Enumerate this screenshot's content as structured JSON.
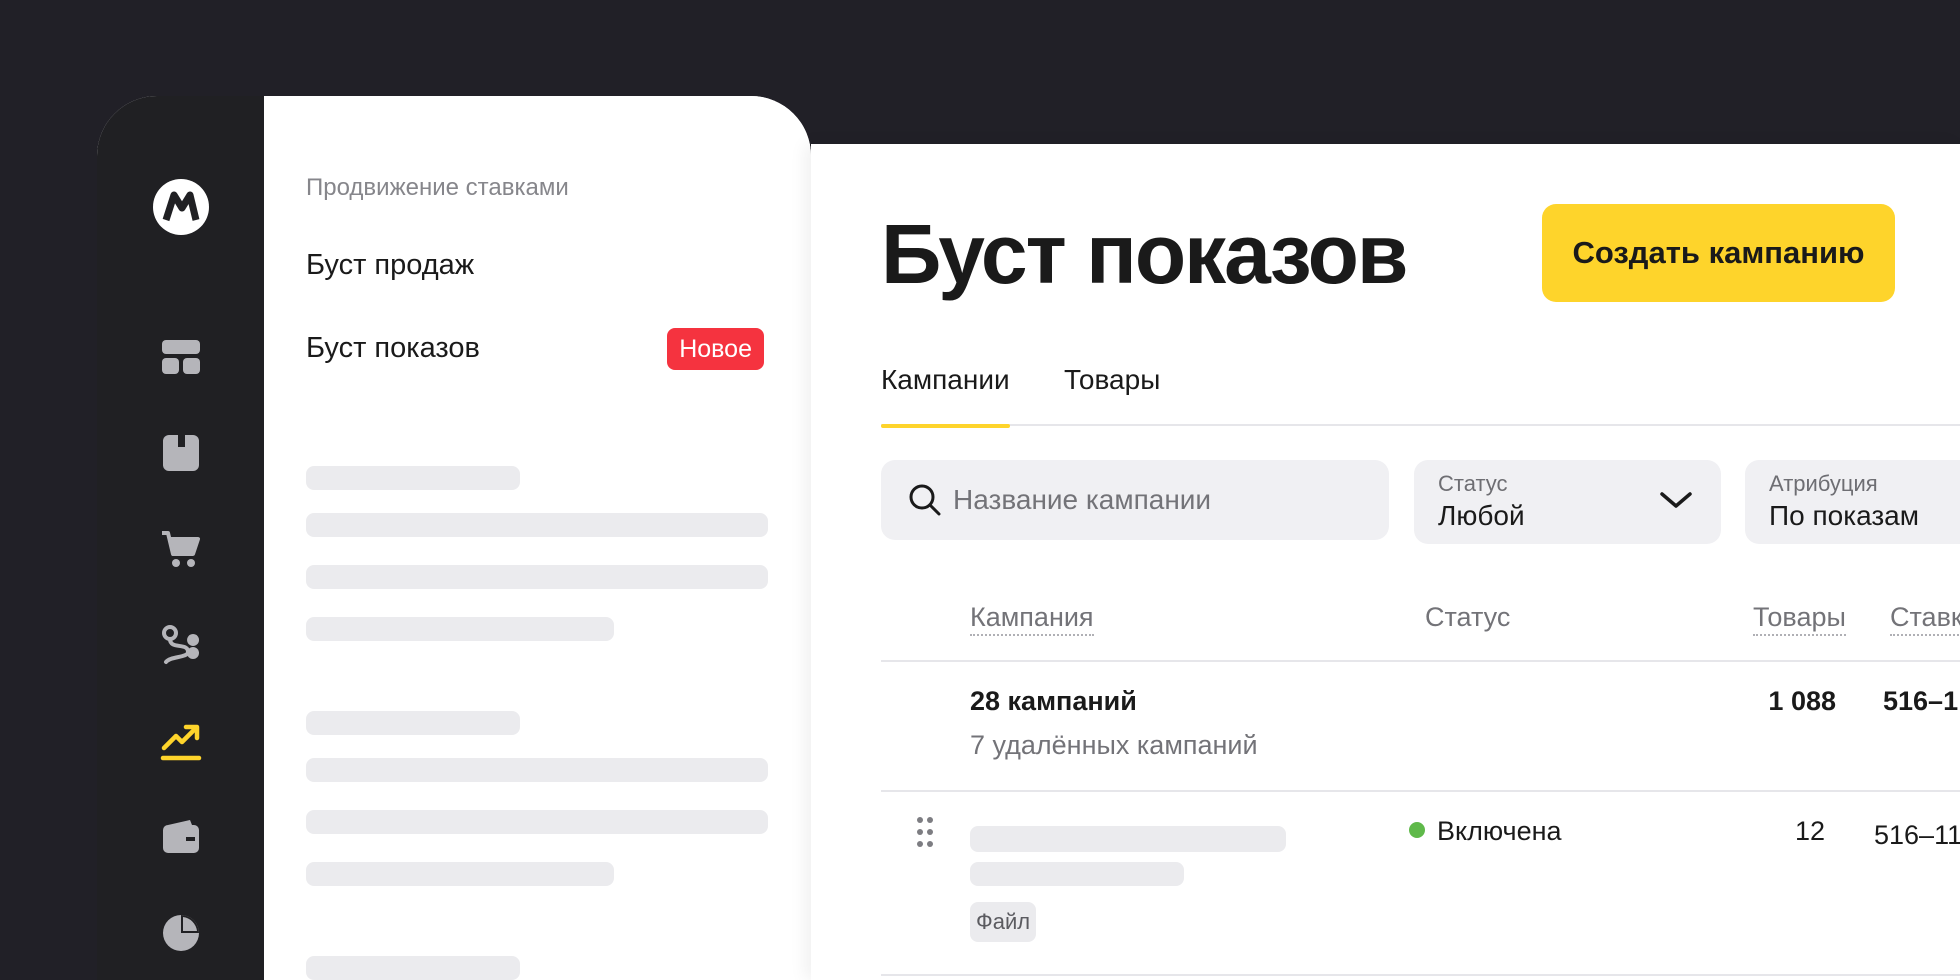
{
  "sidebar": {
    "section_title": "Продвижение ставками",
    "items": [
      {
        "label": "Буст продаж"
      },
      {
        "label": "Буст показов",
        "badge": "Новое"
      }
    ]
  },
  "rail": {
    "icons": [
      "market-logo-icon",
      "dashboard-icon",
      "box-icon",
      "cart-icon",
      "route-icon",
      "growth-icon",
      "wallet-icon",
      "pie-chart-icon"
    ],
    "active_icon": "growth-icon",
    "accent_color": "#fed42b"
  },
  "header": {
    "title": "Буст показов",
    "create_button": "Создать кампанию"
  },
  "tabs": [
    {
      "label": "Кампании",
      "active": true
    },
    {
      "label": "Товары",
      "active": false
    }
  ],
  "filters": {
    "search_placeholder": "Название кампании",
    "status": {
      "label": "Статус",
      "value": "Любой"
    },
    "attribution": {
      "label": "Атрибуция",
      "value": "По показам"
    }
  },
  "table": {
    "columns": [
      "Кампания",
      "Статус",
      "Товары",
      "Ставк"
    ],
    "summary": {
      "title": "28 кампаний",
      "subtitle": "7 удалённых кампаний",
      "products": "1 088",
      "bids": "516–1"
    },
    "rows": [
      {
        "status": "Включена",
        "status_color": "#5fb94a",
        "products": "12",
        "bids": "516–11",
        "tag": "Файл"
      }
    ]
  }
}
